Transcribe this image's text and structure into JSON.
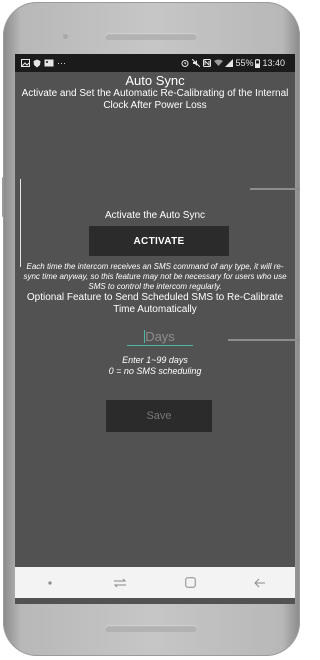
{
  "status_bar": {
    "left_icons": [
      "gallery-icon",
      "shield-icon",
      "image-icon",
      "more-dots-icon"
    ],
    "more_text": "···",
    "right_icons": [
      "alarm-icon",
      "mute-icon",
      "nfc-icon",
      "wifi-icon",
      "signal-icon"
    ],
    "battery_text": "55%",
    "time": "13:40"
  },
  "app": {
    "title": "Auto Sync",
    "subtitle": "Activate and Set the Automatic Re-Calibrating of the Internal Clock After Power Loss"
  },
  "activate_section": {
    "label": "Activate the Auto Sync",
    "button_label": "ACTIVATE",
    "note": "Each time the intercom receives an SMS command of any type, it will re-sync time anyway, so this feature may not be necessary for users who use SMS to control the intercom regularly."
  },
  "schedule_section": {
    "label": "Optional Feature to Send Scheduled SMS to Re-Calibrate Time Automatically",
    "days_input": {
      "value": "",
      "placeholder": "Days"
    },
    "hint_line1": "Enter 1~99 days",
    "hint_line2": "0 = no SMS scheduling",
    "save_label": "Save"
  },
  "nav_bar": {
    "items": [
      "dot-icon",
      "recent-apps-icon",
      "home-icon",
      "back-icon"
    ]
  },
  "colors": {
    "screen_bg": "#525252",
    "button_bg": "#2b2b2b",
    "accent": "#4fb5a8",
    "navbar_bg": "#f3f3f3"
  }
}
